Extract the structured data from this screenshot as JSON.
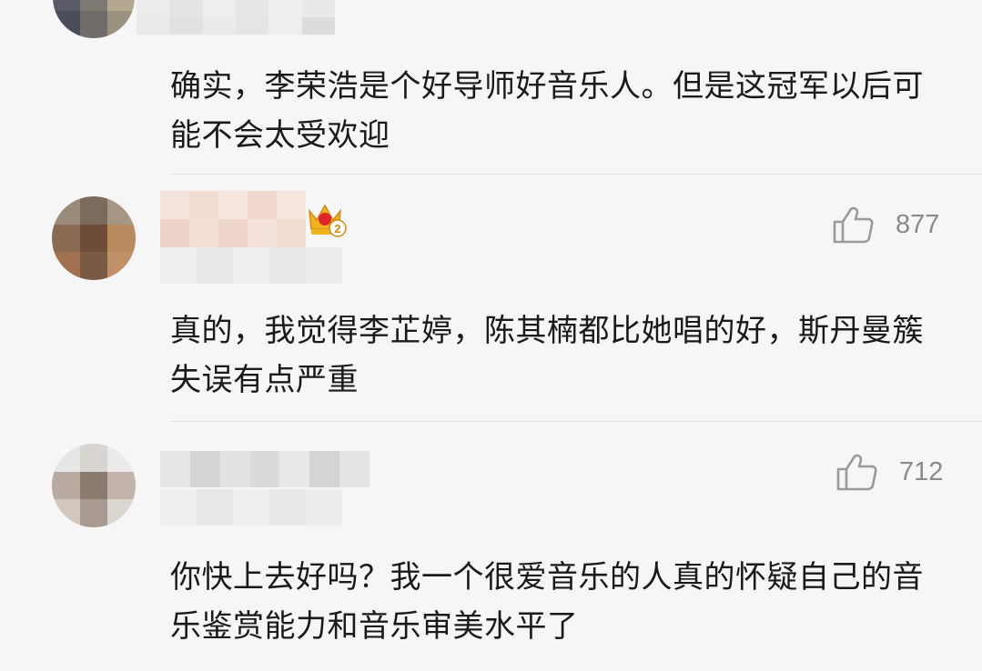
{
  "comments": [
    {
      "text": "确实，李荣浩是个好导师好音乐人。但是这冠军以后可能不会太受欢迎",
      "likes": ""
    },
    {
      "text": "真的，我觉得李芷婷，陈其楠都比她唱的好，斯丹曼簇失误有点严重",
      "likes": "877",
      "badge": "2"
    },
    {
      "text": "你快上去好吗？我一个很爱音乐的人真的怀疑自己的音乐鉴赏能力和音乐审美水平了",
      "likes": "712"
    }
  ],
  "colors": {
    "text": "#1a1a1a",
    "like_icon": "#9a9a9a",
    "like_count": "#8a8a8a",
    "crown_gold": "#f2b21c",
    "crown_red": "#e0242c"
  },
  "icons": {
    "like": "thumbs-up-icon",
    "badge": "crown-badge-icon"
  }
}
